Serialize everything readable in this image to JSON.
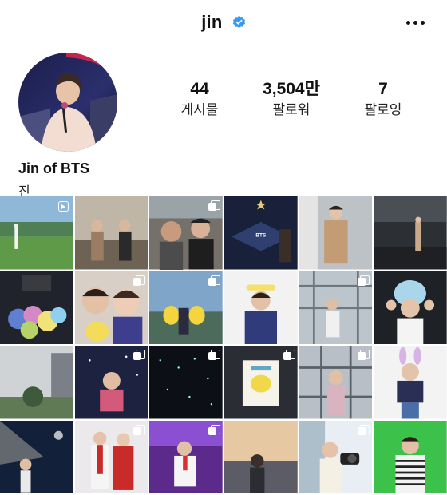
{
  "header": {
    "username": "jin",
    "verified_icon": "verified-badge-icon",
    "menu_icon": "more-options-icon"
  },
  "profile": {
    "full_name": "Jin of BTS",
    "bio": "진",
    "stats": [
      {
        "value": "44",
        "label": "게시물"
      },
      {
        "value": "3,504만",
        "label": "팔로워"
      },
      {
        "value": "7",
        "label": "팔로잉"
      }
    ]
  },
  "grid": {
    "posts": [
      {
        "desc": "golf course",
        "icon": "reel-icon"
      },
      {
        "desc": "two men on terrace",
        "icon": ""
      },
      {
        "desc": "selfie with man in cap",
        "icon": "carousel-icon"
      },
      {
        "desc": "Allegiant Stadium sign",
        "icon": ""
      },
      {
        "desc": "man in beige coat",
        "icon": ""
      },
      {
        "desc": "warehouse interior",
        "icon": ""
      },
      {
        "desc": "flower bouquet",
        "icon": ""
      },
      {
        "desc": "selfie with plush",
        "icon": "carousel-icon"
      },
      {
        "desc": "pikachu figures",
        "icon": "carousel-icon"
      },
      {
        "desc": "pose with sign",
        "icon": ""
      },
      {
        "desc": "scaffold stage",
        "icon": "carousel-icon"
      },
      {
        "desc": "bunny hat pose",
        "icon": ""
      },
      {
        "desc": "cloudy street",
        "icon": ""
      },
      {
        "desc": "stage performance",
        "icon": "carousel-icon"
      },
      {
        "desc": "starry concert",
        "icon": "carousel-icon"
      },
      {
        "desc": "psyduck card",
        "icon": "carousel-icon"
      },
      {
        "desc": "singing on scaffold",
        "icon": "carousel-icon"
      },
      {
        "desc": "purple bunny ears",
        "icon": ""
      },
      {
        "desc": "concert lights",
        "icon": ""
      },
      {
        "desc": "red suits duo",
        "icon": "carousel-icon"
      },
      {
        "desc": "white suit on stage",
        "icon": "carousel-icon"
      },
      {
        "desc": "city view window",
        "icon": ""
      },
      {
        "desc": "camera holding",
        "icon": "carousel-icon"
      },
      {
        "desc": "green screen",
        "icon": ""
      }
    ]
  }
}
